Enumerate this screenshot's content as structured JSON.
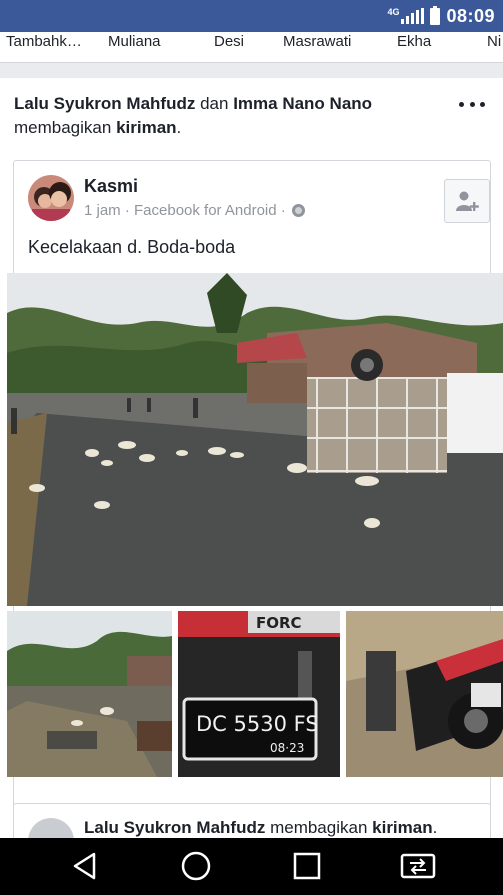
{
  "status_bar": {
    "network": "4G",
    "time": "08:09"
  },
  "names_row": [
    "Tambahk…",
    "Muliana",
    "Desi",
    "Masrawati",
    "Ekha",
    "Ni"
  ],
  "share_header": {
    "name1": "Lalu Syukron Mahfudz",
    "connector": "dan",
    "name2": "Imma Nano Nano",
    "action": "membagikan",
    "object": "kiriman",
    "period": "."
  },
  "post": {
    "author": "Kasmi",
    "meta": "1 jam · Facebook for Android ·",
    "text": "Kecelakaan d. Boda-boda",
    "plate_number": "DC 5530 FS",
    "plate_date": "08·23",
    "bike_brand": "FORC"
  },
  "next_post": {
    "name": "Lalu Syukron Mahfudz",
    "action": "membagikan",
    "object": "kiriman",
    "period": "."
  },
  "icons": {
    "more": "more-horizontal-icon",
    "add_friend": "add-friend-icon",
    "privacy": "globe-icon",
    "back": "back-icon",
    "home": "home-icon",
    "recents": "recents-icon",
    "switch": "switch-app-icon"
  },
  "colors": {
    "brand": "#3b5998",
    "text": "#1d2129",
    "meta": "#90949c",
    "background": "#e9ebee"
  }
}
